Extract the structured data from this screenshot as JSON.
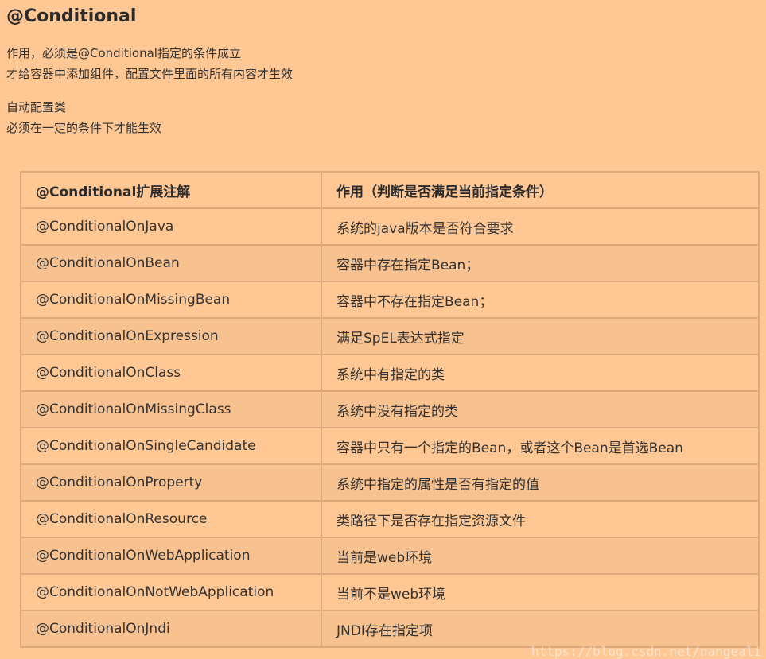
{
  "heading": "@Conditional",
  "intro": {
    "line1": "作用，必须是@Conditional指定的条件成立",
    "line2": "才给容器中添加组件，配置文件里面的所有内容才生效"
  },
  "auto_config": {
    "line1": "自动配置类",
    "line2": "必须在一定的条件下才能生效"
  },
  "table": {
    "headers": [
      "@Conditional扩展注解",
      "作用（判断是否满足当前指定条件）"
    ],
    "rows": [
      [
        "@ConditionalOnJava",
        "系统的java版本是否符合要求"
      ],
      [
        "@ConditionalOnBean",
        "容器中存在指定Bean；"
      ],
      [
        "@ConditionalOnMissingBean",
        "容器中不存在指定Bean；"
      ],
      [
        "@ConditionalOnExpression",
        "满足SpEL表达式指定"
      ],
      [
        "@ConditionalOnClass",
        "系统中有指定的类"
      ],
      [
        "@ConditionalOnMissingClass",
        "系统中没有指定的类"
      ],
      [
        "@ConditionalOnSingleCandidate",
        "容器中只有一个指定的Bean，或者这个Bean是首选Bean"
      ],
      [
        "@ConditionalOnProperty",
        "系统中指定的属性是否有指定的值"
      ],
      [
        "@ConditionalOnResource",
        "类路径下是否存在指定资源文件"
      ],
      [
        "@ConditionalOnWebApplication",
        "当前是web环境"
      ],
      [
        "@ConditionalOnNotWebApplication",
        "当前不是web环境"
      ],
      [
        "@ConditionalOnJndi",
        "JNDI存在指定项"
      ]
    ]
  },
  "watermark": "https://blog.csdn.net/nangeali",
  "colors": {
    "background": "#fec793",
    "row_alt": "#f7c190",
    "border": "#dca87c"
  }
}
